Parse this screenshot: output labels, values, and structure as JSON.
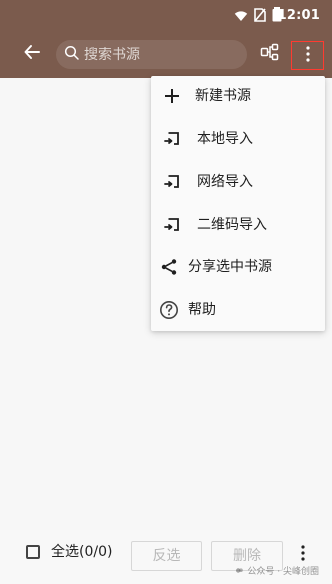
{
  "status_bar": {
    "time": "12:01",
    "icons": [
      "wifi-icon",
      "no-sim-icon",
      "battery-icon"
    ]
  },
  "toolbar": {
    "search_placeholder": "搜索书源",
    "icons": [
      "back-arrow-icon",
      "search-icon",
      "share-tree-icon",
      "more-vert-icon"
    ]
  },
  "menu": {
    "items": [
      {
        "label": "新建书源",
        "icon": "plus-icon"
      },
      {
        "label": "本地导入",
        "icon": "import-icon"
      },
      {
        "label": "网络导入",
        "icon": "import-icon"
      },
      {
        "label": "二维码导入",
        "icon": "import-icon"
      },
      {
        "label": "分享选中书源",
        "icon": "share-icon"
      },
      {
        "label": "帮助",
        "icon": "help-icon"
      }
    ]
  },
  "bottom_bar": {
    "select_all_label": "全选(0/0)",
    "invert_label": "反选",
    "delete_label": "删除",
    "more_icon": "more-vert-icon"
  },
  "watermark": {
    "text": "公众号 · 尖峰创圈"
  },
  "colors": {
    "header": "#7b5b4d",
    "highlight": "#ff3b30",
    "background": "#f7f7f7",
    "menu_background": "#fafafa",
    "text": "#1f1f1f",
    "disabled_text": "#b8b8b8"
  }
}
